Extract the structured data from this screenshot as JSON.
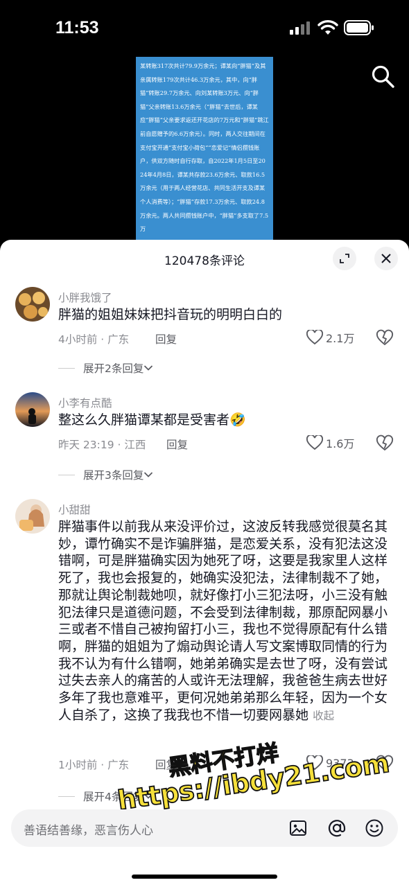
{
  "status_bar": {
    "time": "11:53"
  },
  "video": {
    "document_text": "某转账317次共计79.9万余元；谭某向“胖猫”及其亲属转账179次共计46.3万余元，其中，向“胖猫”转账29.7万余元、向刘某转账3万元、向“胖猫”父亲转账13.6万余元（“胖猫”去世后，谭某应“胖猫”父亲要求返还开花店的7万元和“胖猫”跳江前自愿赠予的6.6万余元）。同时，两人交往期间在支付宝开通“支付宝小荷包”“恋爱记”情侣攒钱账户，供双方随时自行存取，自2022年1月5日至2024年4月8日，谭某共存款23.6万余元、取款16.5万余元（用于两人经营花店、共同生活开支及谭某个人消费等）；“胖猫”存款17.3万余元、取款24.8万余元。两人共同攒钱账户中，“胖猫”多支取了7.5万",
    "doc_color": "#3a8fd0"
  },
  "sheet": {
    "title": "120478条评论"
  },
  "comments": [
    {
      "username": "小胖我饿了",
      "text": "胖猫的姐姐妹妹把抖音玩的明明白白的",
      "time_location": "4小时前 · 广东",
      "reply_label": "回复",
      "likes": "2.1万",
      "more_replies": "展开2条回复"
    },
    {
      "username": "小李有点酷",
      "text": "整这么久胖猫谭某都是受害者",
      "emoji": "🤣",
      "time_location": "昨天 23:19 · 江西",
      "reply_label": "回复",
      "likes": "1.6万",
      "more_replies": "展开3条回复"
    },
    {
      "username": "小甜甜",
      "text": "胖猫事件以前我从来没评价过，这波反转我感觉很莫名其妙，谭竹确实不是诈骗胖猫，是恋爱关系，没有犯法这没错啊，可是胖猫确实因为她死了呀，这要是我家里人这样死了，我也会报复的，她确实没犯法，法律制裁不了她，那就让舆论制裁她呗，就好像打小三犯法呀，小三没有触犯法律只是道德问题，不会受到法律制裁，那原配网暴小三或者不惜自己被拘留打小三，我也不觉得原配有什么错啊，胖猫的姐姐为了煽动舆论请人写文案博取同情的行为我不认为有什么错啊，她弟弟确实是去世了呀，没有尝试过失去亲人的痛苦的人或许无法理解，我爸爸生病去世好多年了我也意难平，更何况她弟弟那么年轻，因为一个女人自杀了，这换了我我也不惜一切要网暴她",
      "collapse_label": "收起",
      "time_location": "1小时前 · 广东",
      "reply_label": "回复",
      "likes": "9373",
      "more_replies": "展开4条回复"
    }
  ],
  "watermark": {
    "line1": "黑料不打烊",
    "line2": "https://ibdy21.com"
  },
  "input_bar": {
    "placeholder": "善语结善缘，恶言伤人心"
  }
}
